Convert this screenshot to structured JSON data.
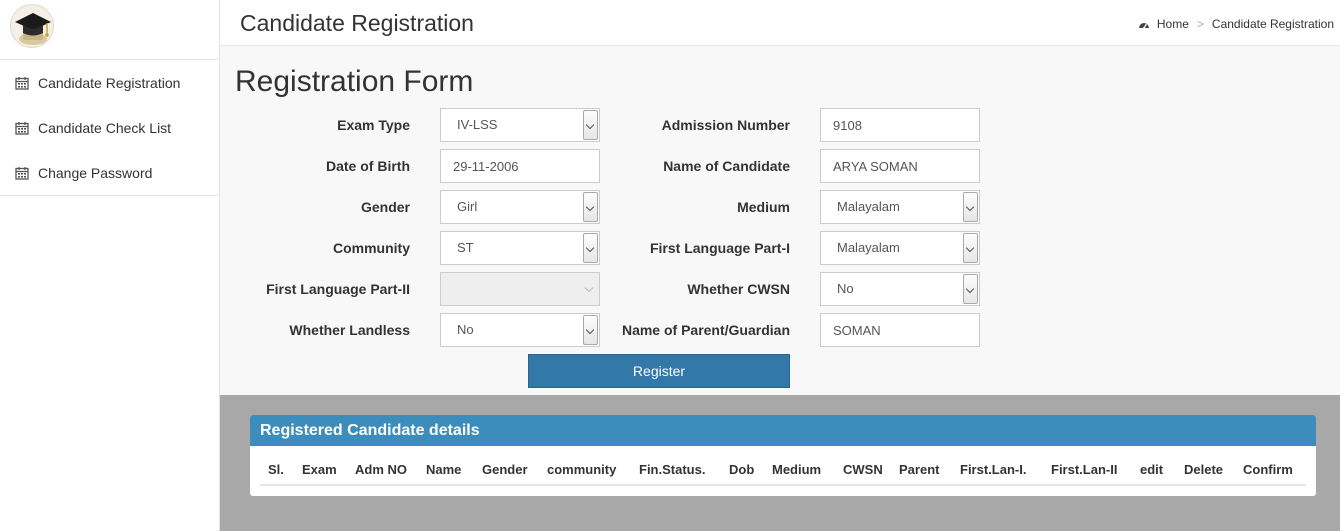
{
  "sidebar": {
    "items": [
      {
        "label": "Candidate Registration",
        "icon": "calendar-icon"
      },
      {
        "label": "Candidate Check List",
        "icon": "calendar-icon"
      },
      {
        "label": "Change Password",
        "icon": "calendar-icon"
      }
    ]
  },
  "header": {
    "title": "Candidate Registration",
    "breadcrumb": {
      "home": "Home",
      "separator": ">",
      "current": "Candidate Registration"
    }
  },
  "form": {
    "title": "Registration Form",
    "exam_type": {
      "label": "Exam Type",
      "value": "IV-LSS"
    },
    "admission_number": {
      "label": "Admission Number",
      "value": "9108"
    },
    "dob": {
      "label": "Date of Birth",
      "value": "29-11-2006"
    },
    "candidate_name": {
      "label": "Name of Candidate",
      "value": "ARYA SOMAN"
    },
    "gender": {
      "label": "Gender",
      "value": "Girl"
    },
    "medium": {
      "label": "Medium",
      "value": "Malayalam"
    },
    "community": {
      "label": "Community",
      "value": "ST"
    },
    "first_lang_1": {
      "label": "First Language Part-I",
      "value": "Malayalam"
    },
    "first_lang_2": {
      "label": "First Language Part-II",
      "value": ""
    },
    "cwsn": {
      "label": "Whether CWSN",
      "value": "No"
    },
    "landless": {
      "label": "Whether Landless",
      "value": "No"
    },
    "parent": {
      "label": "Name of Parent/Guardian",
      "value": "SOMAN"
    },
    "register_label": "Register"
  },
  "table": {
    "title": "Registered Candidate details",
    "columns": [
      "Sl.",
      "Exam",
      "Adm NO",
      "Name",
      "Gender",
      "community",
      "Fin.Status.",
      "Dob",
      "Medium",
      "CWSN",
      "Parent",
      "First.Lan-I.",
      "First.Lan-II",
      "edit",
      "Delete",
      "Confirm"
    ]
  },
  "colors": {
    "accent": "#3c8dbc",
    "button": "#3278a8",
    "form_bg": "#f8f8f8",
    "lower_bg": "#a8a8a8"
  }
}
